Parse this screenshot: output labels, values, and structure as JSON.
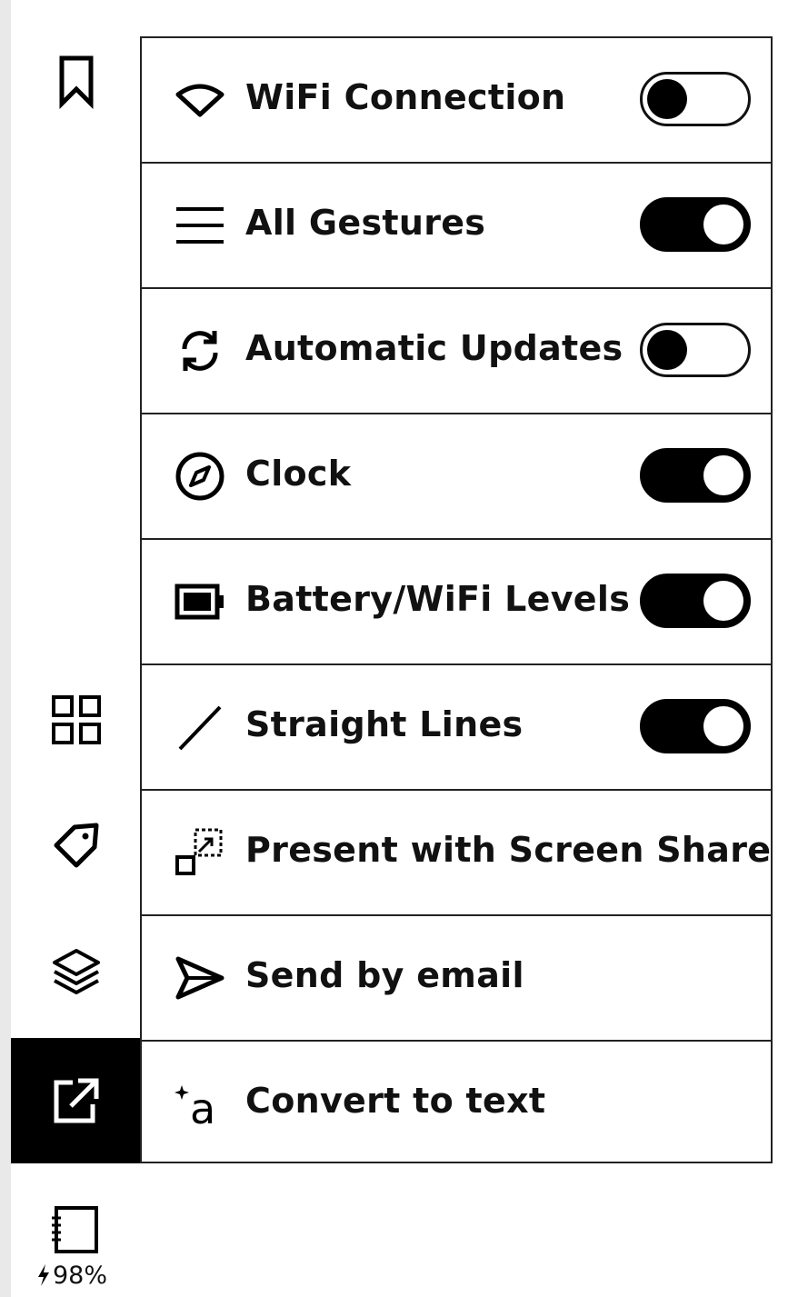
{
  "sidebar": {
    "items": [
      {
        "icon": "bookmark-icon"
      },
      {
        "icon": "grid-icon"
      },
      {
        "icon": "tag-icon"
      },
      {
        "icon": "layers-icon"
      },
      {
        "icon": "export-icon",
        "active": true
      }
    ],
    "battery": {
      "icon": "notebook-icon",
      "charging_icon": "lightning-icon",
      "level": "98%"
    }
  },
  "menu": {
    "items": [
      {
        "label": "WiFi Connection",
        "icon": "wifi-icon",
        "toggle": "off"
      },
      {
        "label": "All Gestures",
        "icon": "menu-lines-icon",
        "toggle": "on"
      },
      {
        "label": "Automatic Updates",
        "icon": "sync-icon",
        "toggle": "off"
      },
      {
        "label": "Clock",
        "icon": "compass-icon",
        "toggle": "on"
      },
      {
        "label": "Battery/WiFi Levels",
        "icon": "battery-icon",
        "toggle": "on"
      },
      {
        "label": "Straight Lines",
        "icon": "line-icon",
        "toggle": "on"
      },
      {
        "label": "Present with Screen Share",
        "icon": "screen-share-icon"
      },
      {
        "label": "Send by email",
        "icon": "send-icon"
      },
      {
        "label": "Convert to text",
        "icon": "convert-text-icon"
      }
    ]
  },
  "colors": {
    "foreground": "#000000",
    "background": "#ffffff",
    "edge": "#e9e9e9"
  }
}
